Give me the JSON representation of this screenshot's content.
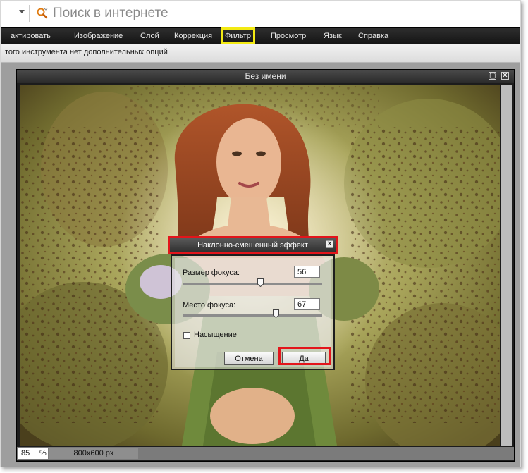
{
  "search": {
    "placeholder": "Поиск в интернете"
  },
  "menu": {
    "items": [
      {
        "label": "актировать"
      },
      {
        "label": "Изображение"
      },
      {
        "label": "Слой"
      },
      {
        "label": "Коррекция"
      },
      {
        "label": "Фильтр"
      },
      {
        "label": "Просмотр"
      },
      {
        "label": "Язык"
      },
      {
        "label": "Справка"
      }
    ]
  },
  "options_bar": {
    "text": "того инструмента нет дополнительных опций"
  },
  "document": {
    "title": "Без имени",
    "zoom_value": "85",
    "zoom_unit": "%",
    "size": "800x600 px"
  },
  "dialog": {
    "title": "Наклонно-смешенный эффект",
    "focus_size_label": "Размер фокуса:",
    "focus_size_value": "56",
    "focus_pos_label": "Место фокуса:",
    "focus_pos_value": "67",
    "saturation_label": "Насыщение",
    "saturation_checked": false,
    "cancel_label": "Отмена",
    "ok_label": "Да"
  },
  "colors": {
    "highlight_red": "#e3151b",
    "highlight_yellow": "#f3ea13",
    "menubar": "#1f1f1f"
  }
}
